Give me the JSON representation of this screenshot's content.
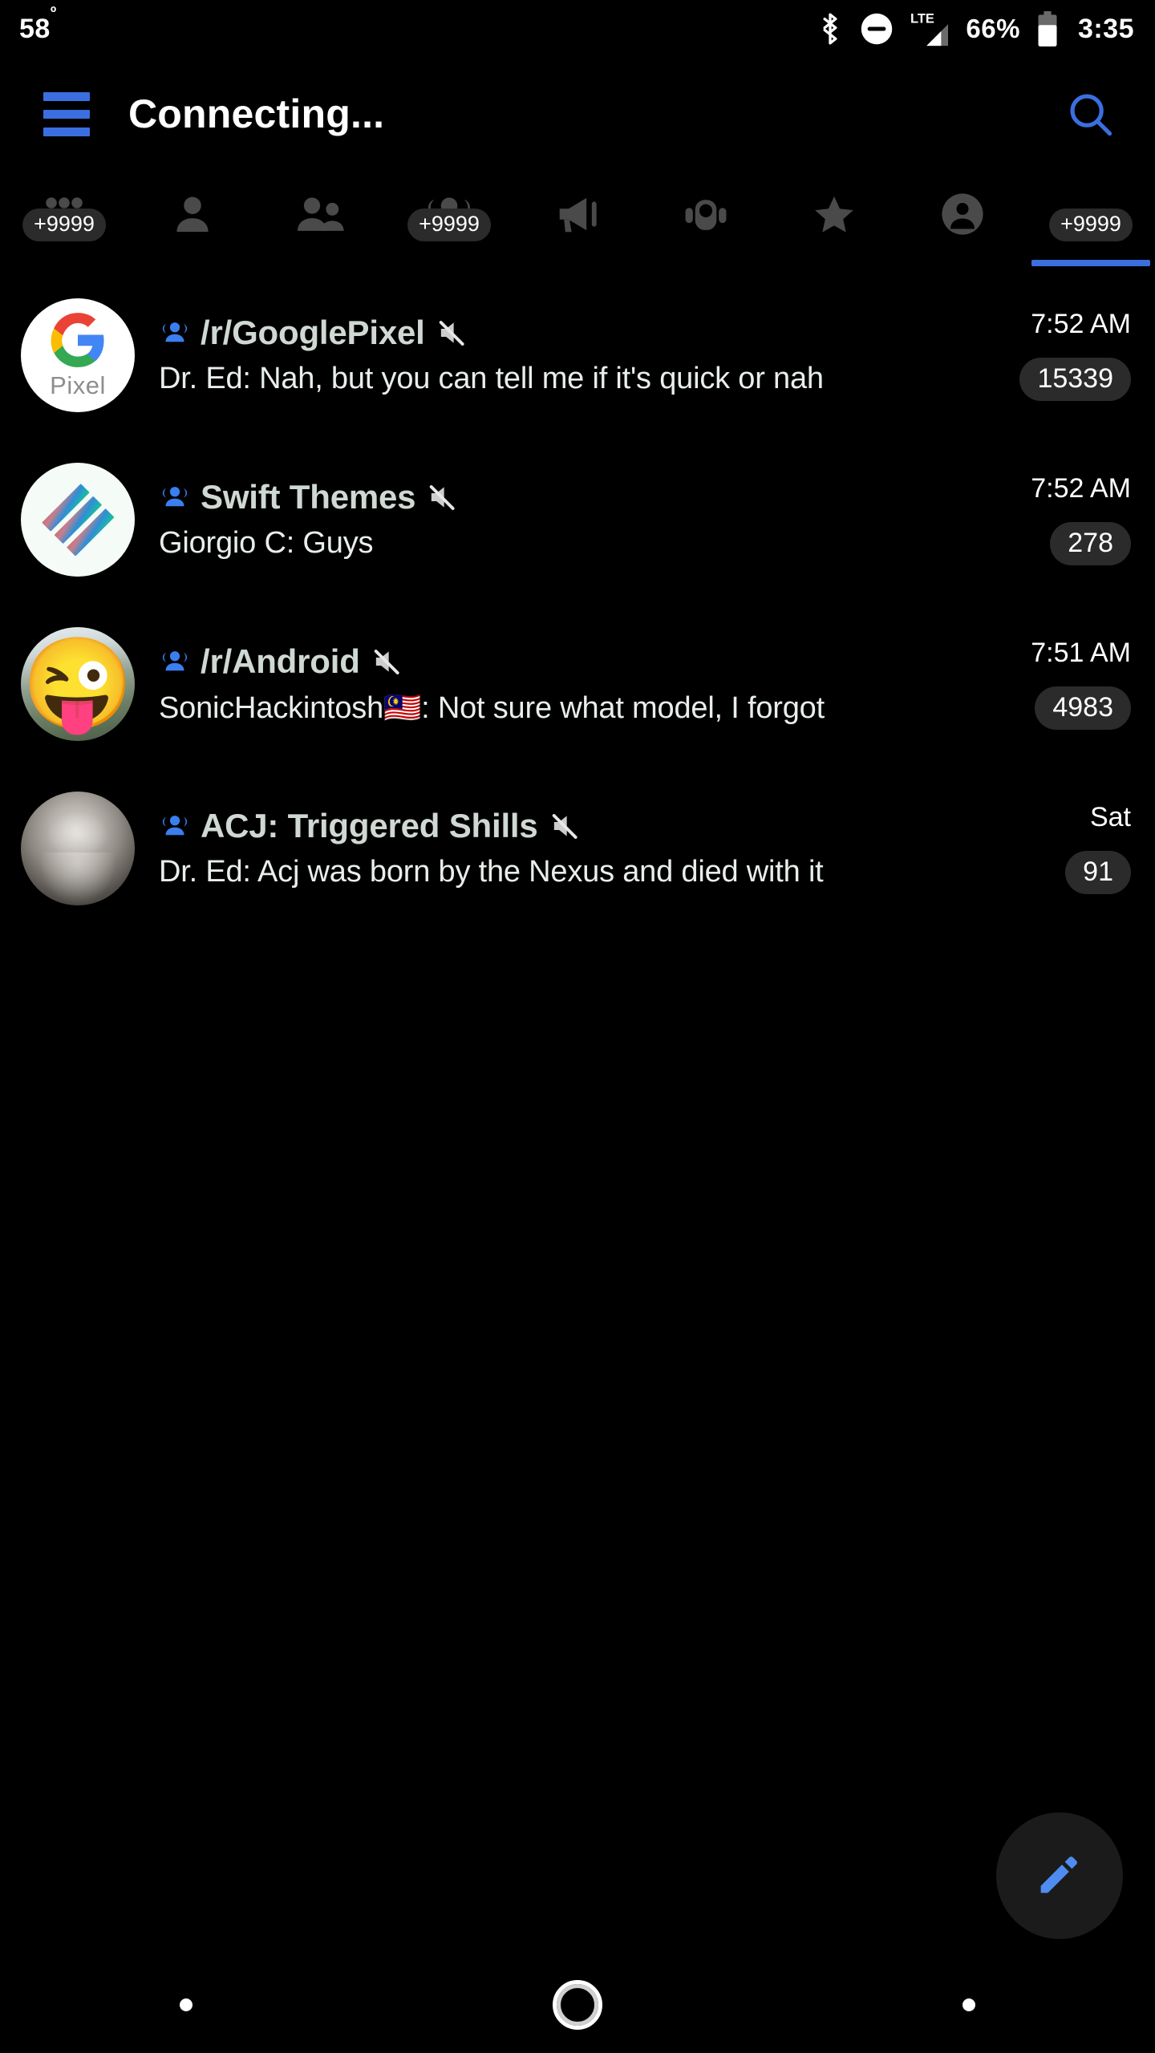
{
  "statusbar": {
    "temperature": "58",
    "degree": "º",
    "bluetooth_icon": "bluetooth-icon",
    "dnd_icon": "do-not-disturb-icon",
    "network_type": "LTE",
    "signal_icon": "cellular-signal-icon",
    "battery_percent": "66%",
    "battery_icon": "battery-icon",
    "clock": "3:35"
  },
  "appbar": {
    "menu_icon": "hamburger-menu-icon",
    "title": "Connecting...",
    "search_icon": "search-icon",
    "accent_color": "#3b6fe0"
  },
  "tabs": [
    {
      "name": "tab-all-chats",
      "icon": "grid-dots-icon",
      "badge": "+9999",
      "active": false
    },
    {
      "name": "tab-contacts",
      "icon": "person-icon",
      "badge": "",
      "active": false
    },
    {
      "name": "tab-private-chats",
      "icon": "two-people-icon",
      "badge": "",
      "active": false
    },
    {
      "name": "tab-groups",
      "icon": "group-people-icon",
      "badge": "+9999",
      "active": false
    },
    {
      "name": "tab-channels",
      "icon": "megaphone-icon",
      "badge": "",
      "active": false
    },
    {
      "name": "tab-bots",
      "icon": "robot-icon",
      "badge": "",
      "active": false
    },
    {
      "name": "tab-favorites",
      "icon": "star-icon",
      "badge": "",
      "active": false
    },
    {
      "name": "tab-contact-circle",
      "icon": "contact-badge-icon",
      "badge": "",
      "active": false
    },
    {
      "name": "tab-unread",
      "icon": "unread-circle-icon",
      "badge": "+9999",
      "active": true
    }
  ],
  "chats": [
    {
      "avatar_type": "pixel-logo",
      "avatar_label": "Pixel",
      "group_icon": "group-people-icon",
      "name": "/r/GooglePixel",
      "mute_icon": "muted-speaker-icon",
      "message": "Dr. Ed: Nah, but you can tell me if it's quick or nah",
      "time": "7:52 AM",
      "unread": "15339"
    },
    {
      "avatar_type": "swift-stripes",
      "avatar_label": "",
      "group_icon": "group-people-icon",
      "name": "Swift Themes",
      "mute_icon": "muted-speaker-icon",
      "message": "Giorgio C: Guys",
      "time": "7:52 AM",
      "unread": "278"
    },
    {
      "avatar_type": "emoji-photo",
      "avatar_label": "😜",
      "group_icon": "group-people-icon",
      "name": "/r/Android",
      "mute_icon": "muted-speaker-icon",
      "message": "SonicHackintosh🇲🇾: Not sure what model, I forgot",
      "time": "7:51 AM",
      "unread": "4983"
    },
    {
      "avatar_type": "grayscale-photo",
      "avatar_label": "",
      "group_icon": "group-people-icon",
      "name": "ACJ: Triggered Shills",
      "mute_icon": "muted-speaker-icon",
      "message": "Dr. Ed: Acj was born by the Nexus and died with it",
      "time": "Sat",
      "unread": "91"
    }
  ],
  "fab": {
    "icon": "pencil-edit-icon",
    "color": "#4e8cf0"
  },
  "navbar": {
    "back_icon": "nav-dot-left",
    "home_icon": "nav-home-circle",
    "recents_icon": "nav-dot-right"
  },
  "colors": {
    "background": "#000000",
    "accent": "#3b6fe0",
    "badge_bg": "#2b2b2b",
    "chat_name": "#cfd8d2",
    "chat_message": "#e8eeea",
    "tab_inactive": "#4a4a4a"
  }
}
